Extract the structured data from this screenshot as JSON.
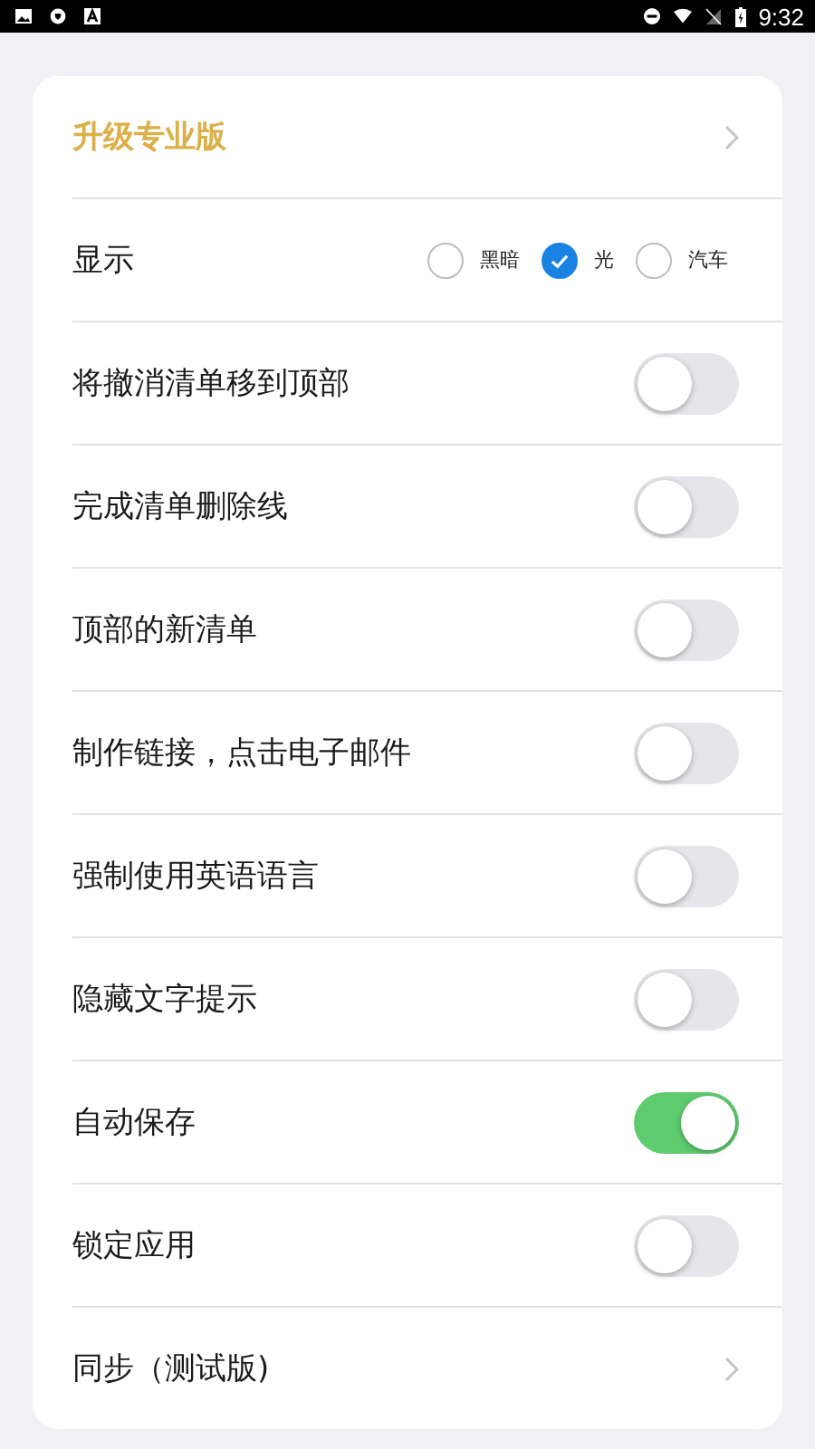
{
  "status_bar": {
    "time": "9:32"
  },
  "settings": [
    {
      "kind": "link",
      "label": "升级专业版",
      "accent": true
    },
    {
      "kind": "radio",
      "label": "显示",
      "options": [
        {
          "label": "黑暗",
          "selected": false
        },
        {
          "label": "光",
          "selected": true
        },
        {
          "label": "汽车",
          "selected": false
        }
      ]
    },
    {
      "kind": "toggle",
      "label": "将撤消清单移到顶部",
      "on": false
    },
    {
      "kind": "toggle",
      "label": "完成清单删除线",
      "on": false
    },
    {
      "kind": "toggle",
      "label": "顶部的新清单",
      "on": false
    },
    {
      "kind": "toggle",
      "label": "制作链接，点击电子邮件",
      "on": false
    },
    {
      "kind": "toggle",
      "label": "强制使用英语语言",
      "on": false
    },
    {
      "kind": "toggle",
      "label": "隐藏文字提示",
      "on": false
    },
    {
      "kind": "toggle",
      "label": "自动保存",
      "on": true
    },
    {
      "kind": "toggle",
      "label": "锁定应用",
      "on": false
    },
    {
      "kind": "link",
      "label": "同步（测试版)",
      "accent": false
    }
  ]
}
